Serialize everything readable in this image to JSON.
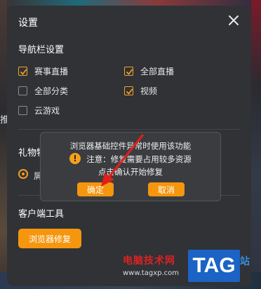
{
  "background": {
    "left_label": "推"
  },
  "panel": {
    "title": "设置"
  },
  "nav_settings": {
    "title": "导航栏设置",
    "items": [
      {
        "label": "赛事直播",
        "checked": true
      },
      {
        "label": "全部直播",
        "checked": true
      },
      {
        "label": "全部分类",
        "checked": false
      },
      {
        "label": "视频",
        "checked": true
      },
      {
        "label": "云游戏",
        "checked": false
      }
    ]
  },
  "gift_section": {
    "title": "礼物特",
    "radio_label": "屑"
  },
  "client_tools": {
    "title": "客户端工具",
    "repair_button": "浏览器修复"
  },
  "dialog": {
    "line1": "浏览器基础控件异常时使用该功能",
    "line2": "注意：修复需要占用较多资源",
    "line3": "点击确认开始修复",
    "confirm": "确定",
    "cancel": "取消"
  },
  "watermark": {
    "text": "电脑技术网",
    "url": "www.tagxp.com",
    "badge": "TAG",
    "suffix": "站"
  },
  "colors": {
    "accent": "#f5960e",
    "panel": "#303236",
    "dialog": "#3a3c40"
  }
}
